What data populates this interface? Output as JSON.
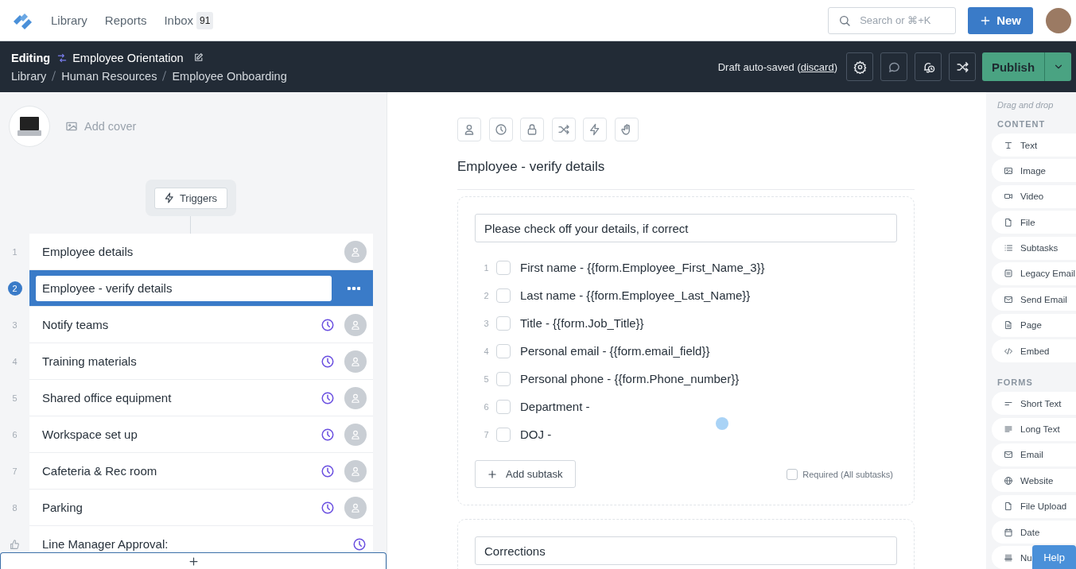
{
  "top_nav": {
    "items": [
      {
        "label": "Library"
      },
      {
        "label": "Reports"
      },
      {
        "label": "Inbox",
        "badge": "91"
      }
    ],
    "search": {
      "placeholder": "Search or ⌘+K"
    },
    "new_button": "New"
  },
  "editor_bar": {
    "mode": "Editing",
    "title": "Employee Orientation",
    "breadcrumbs": [
      "Library",
      "Human Resources",
      "Employee Onboarding"
    ],
    "status_prefix": "Draft auto-saved (",
    "discard": "discard",
    "status_suffix": ")",
    "publish": "Publish"
  },
  "sidebar": {
    "add_cover": "Add cover",
    "triggers": "Triggers",
    "tasks": [
      {
        "kind": "task",
        "number": "1",
        "label": "Employee details",
        "selected": false,
        "due": false
      },
      {
        "kind": "task",
        "number": "2",
        "label": "Employee - verify details",
        "selected": true,
        "due": false
      },
      {
        "kind": "task",
        "number": "3",
        "label": "Notify teams",
        "selected": false,
        "due": true
      },
      {
        "kind": "task",
        "number": "4",
        "label": "Training materials",
        "selected": false,
        "due": true
      },
      {
        "kind": "task",
        "number": "5",
        "label": "Shared office equipment",
        "selected": false,
        "due": true
      },
      {
        "kind": "task",
        "number": "6",
        "label": "Workspace set up",
        "selected": false,
        "due": true
      },
      {
        "kind": "task",
        "number": "7",
        "label": "Cafeteria & Rec room",
        "selected": false,
        "due": true
      },
      {
        "kind": "task",
        "number": "8",
        "label": "Parking",
        "selected": false,
        "due": true
      },
      {
        "kind": "approval",
        "label": "Line Manager Approval:",
        "selected": false,
        "due": true
      }
    ]
  },
  "step": {
    "title": "Employee - verify details",
    "blocks": [
      {
        "kind": "subtasks",
        "heading": "Please check off your details, if correct",
        "subtasks": [
          {
            "number": "1",
            "label": "First name - {{form.Employee_First_Name_3}}",
            "checked": false
          },
          {
            "number": "2",
            "label": "Last name - {{form.Employee_Last_Name}}",
            "checked": false
          },
          {
            "number": "3",
            "label": "Title - {{form.Job_Title}}",
            "checked": false
          },
          {
            "number": "4",
            "label": "Personal email - {{form.email_field}}",
            "checked": false
          },
          {
            "number": "5",
            "label": "Personal phone - {{form.Phone_number}}",
            "checked": false
          },
          {
            "number": "6",
            "label": "Department -",
            "checked": false
          },
          {
            "number": "7",
            "label": "DOJ -",
            "checked": false
          }
        ],
        "add_label": "Add subtask",
        "required": {
          "label": "Required (All subtasks)",
          "checked": false
        }
      },
      {
        "kind": "text",
        "value": "Corrections"
      }
    ]
  },
  "palette": {
    "hint": "Drag and drop",
    "sections": [
      {
        "title": "CONTENT",
        "items": [
          {
            "kind": "text",
            "label": "Text"
          },
          {
            "kind": "image",
            "label": "Image"
          },
          {
            "kind": "video",
            "label": "Video"
          },
          {
            "kind": "file",
            "label": "File"
          },
          {
            "kind": "subtasks",
            "label": "Subtasks"
          },
          {
            "kind": "legacy_email",
            "label": "Legacy Email"
          },
          {
            "kind": "email",
            "label": "Send Email"
          },
          {
            "kind": "page",
            "label": "Page"
          },
          {
            "kind": "embed",
            "label": "Embed"
          }
        ]
      },
      {
        "title": "FORMS",
        "items": [
          {
            "kind": "short_text",
            "label": "Short Text"
          },
          {
            "kind": "long_text",
            "label": "Long Text"
          },
          {
            "kind": "email",
            "label": "Email"
          },
          {
            "kind": "website",
            "label": "Website"
          },
          {
            "kind": "file",
            "label": "File Upload"
          },
          {
            "kind": "date",
            "label": "Date"
          },
          {
            "kind": "number",
            "label": "Nu"
          }
        ]
      }
    ]
  },
  "help": "Help"
}
